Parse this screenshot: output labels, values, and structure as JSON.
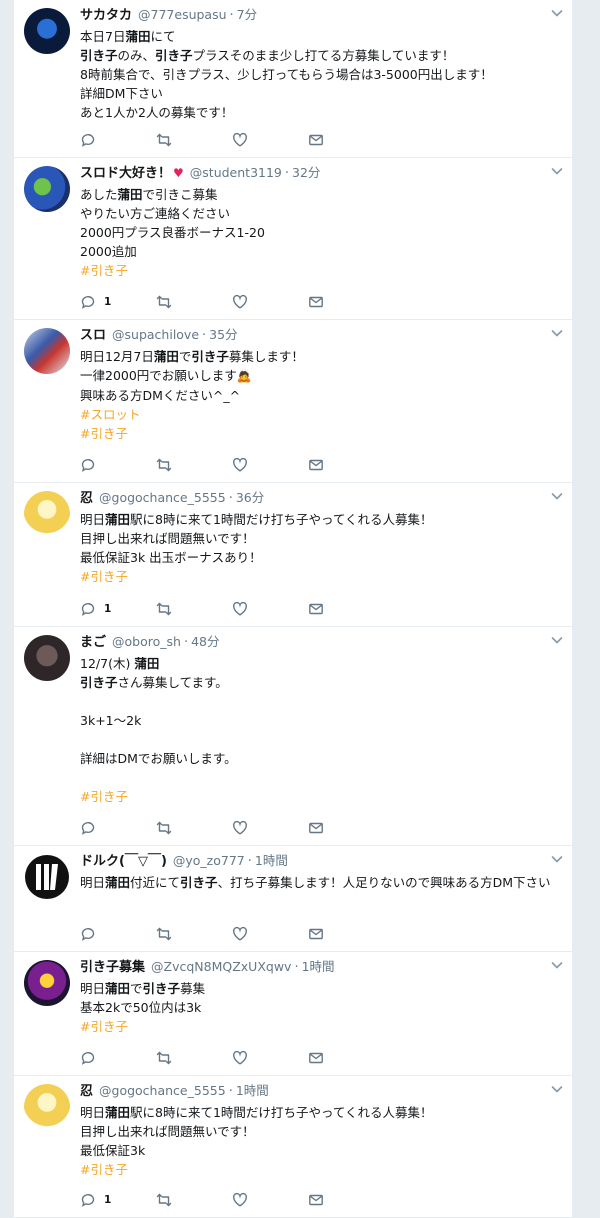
{
  "tweets": [
    {
      "name": "サカタカ",
      "handle": "@777esupasu",
      "time": "7分",
      "lines": [
        {
          "parts": [
            {
              "t": "本日7日"
            },
            {
              "t": "蒲田",
              "b": true
            },
            {
              "t": "にて"
            }
          ]
        },
        {
          "parts": [
            {
              "t": "引き子",
              "b": true
            },
            {
              "t": "のみ、"
            },
            {
              "t": "引き子",
              "b": true
            },
            {
              "t": "プラスそのまま少し打てる方募集しています！"
            }
          ]
        },
        {
          "parts": [
            {
              "t": "8時前集合で、引きプラス、少し打ってもらう場合は3-5000円出します！"
            }
          ]
        },
        {
          "parts": [
            {
              "t": "詳細DM下さい"
            }
          ]
        },
        {
          "parts": [
            {
              "t": "あと1人か2人の募集です！"
            }
          ]
        }
      ],
      "reply_count": ""
    },
    {
      "name": "スロド大好き！",
      "name_emoji": "♥",
      "handle": "@student3119",
      "time": "32分",
      "lines": [
        {
          "parts": [
            {
              "t": "あした"
            },
            {
              "t": "蒲田",
              "b": true
            },
            {
              "t": "で引きこ募集"
            }
          ]
        },
        {
          "parts": [
            {
              "t": "やりたい方ご連絡ください"
            }
          ]
        },
        {
          "parts": [
            {
              "t": "2000円プラス良番ボーナス1-20"
            }
          ]
        },
        {
          "parts": [
            {
              "t": "2000追加"
            }
          ]
        },
        {
          "parts": [
            {
              "t": "#引き子",
              "h": true
            }
          ]
        }
      ],
      "reply_count": "1"
    },
    {
      "name": "スロ",
      "handle": "@supachilove",
      "time": "35分",
      "lines": [
        {
          "parts": [
            {
              "t": "明日12月7日"
            },
            {
              "t": "蒲田",
              "b": true
            },
            {
              "t": "で"
            },
            {
              "t": "引き子",
              "b": true
            },
            {
              "t": "募集します！"
            }
          ]
        },
        {
          "parts": [
            {
              "t": "一律2000円でお願いします"
            },
            {
              "t": "🙇",
              "e": true
            }
          ]
        },
        {
          "parts": [
            {
              "t": "興味ある方DMください^_^"
            }
          ]
        },
        {
          "parts": [
            {
              "t": "#スロット",
              "h": true
            }
          ]
        },
        {
          "parts": [
            {
              "t": "#引き子",
              "h": true
            }
          ]
        }
      ],
      "reply_count": ""
    },
    {
      "name": "忍",
      "handle": "@gogochance_5555",
      "time": "36分",
      "lines": [
        {
          "parts": [
            {
              "t": "明日"
            },
            {
              "t": "蒲田",
              "b": true
            },
            {
              "t": "駅に8時に来て1時間だけ打ち子やってくれる人募集！"
            }
          ]
        },
        {
          "parts": [
            {
              "t": "目押し出来れば問題無いです！"
            }
          ]
        },
        {
          "parts": [
            {
              "t": "最低保証3k 出玉ボーナスあり！"
            }
          ]
        },
        {
          "parts": [
            {
              "t": "#引き子",
              "h": true
            }
          ]
        }
      ],
      "reply_count": "1"
    },
    {
      "name": "まご",
      "handle": "@oboro_sh",
      "time": "48分",
      "lines": [
        {
          "parts": [
            {
              "t": "12/7(木) "
            },
            {
              "t": "蒲田",
              "b": true
            }
          ]
        },
        {
          "parts": [
            {
              "t": "引き子",
              "b": true
            },
            {
              "t": "さん募集してます。"
            }
          ]
        },
        {
          "blank": true
        },
        {
          "parts": [
            {
              "t": "3k+1〜2k"
            }
          ]
        },
        {
          "blank": true
        },
        {
          "parts": [
            {
              "t": "詳細はDMでお願いします。"
            }
          ]
        },
        {
          "blank": true
        },
        {
          "parts": [
            {
              "t": "#引き子",
              "h": true
            }
          ]
        }
      ],
      "reply_count": ""
    },
    {
      "name": "ドルク(￣▽￣)",
      "handle": "@yo_zo777",
      "time": "1時間",
      "lines": [
        {
          "wrap": true,
          "parts": [
            {
              "t": "明日"
            },
            {
              "t": "蒲田",
              "b": true
            },
            {
              "t": "付近にて"
            },
            {
              "t": "引き子",
              "b": true
            },
            {
              "t": "、打ち子募集します！人足りないので興味ある方DM下さい"
            }
          ]
        }
      ],
      "reply_count": ""
    },
    {
      "name": "引き子募集",
      "handle": "@ZvcqN8MQZxUXqwv",
      "time": "1時間",
      "lines": [
        {
          "parts": [
            {
              "t": "明日"
            },
            {
              "t": "蒲田",
              "b": true
            },
            {
              "t": "で"
            },
            {
              "t": "引き子",
              "b": true
            },
            {
              "t": "募集"
            }
          ]
        },
        {
          "parts": [
            {
              "t": "基本2kで50位内は3k"
            }
          ]
        },
        {
          "parts": [
            {
              "t": "#引き子",
              "h": true
            }
          ]
        }
      ],
      "reply_count": ""
    },
    {
      "name": "忍",
      "handle": "@gogochance_5555",
      "time": "1時間",
      "lines": [
        {
          "parts": [
            {
              "t": "明日"
            },
            {
              "t": "蒲田",
              "b": true
            },
            {
              "t": "駅に8時に来て1時間だけ打ち子やってくれる人募集！"
            }
          ]
        },
        {
          "parts": [
            {
              "t": "目押し出来れば問題無いです！"
            }
          ]
        },
        {
          "parts": [
            {
              "t": "最低保証3k"
            }
          ]
        },
        {
          "parts": [
            {
              "t": "#引き子",
              "h": true
            }
          ]
        }
      ],
      "reply_count": "1"
    }
  ],
  "colors": {
    "hashtag": "#f5a623",
    "muted": "#657786",
    "heart": "#e0245e"
  },
  "icons": {
    "reply": "reply-icon",
    "retweet": "retweet-icon",
    "like": "like-icon",
    "dm": "dm-icon",
    "caret": "chevron-down-icon"
  }
}
